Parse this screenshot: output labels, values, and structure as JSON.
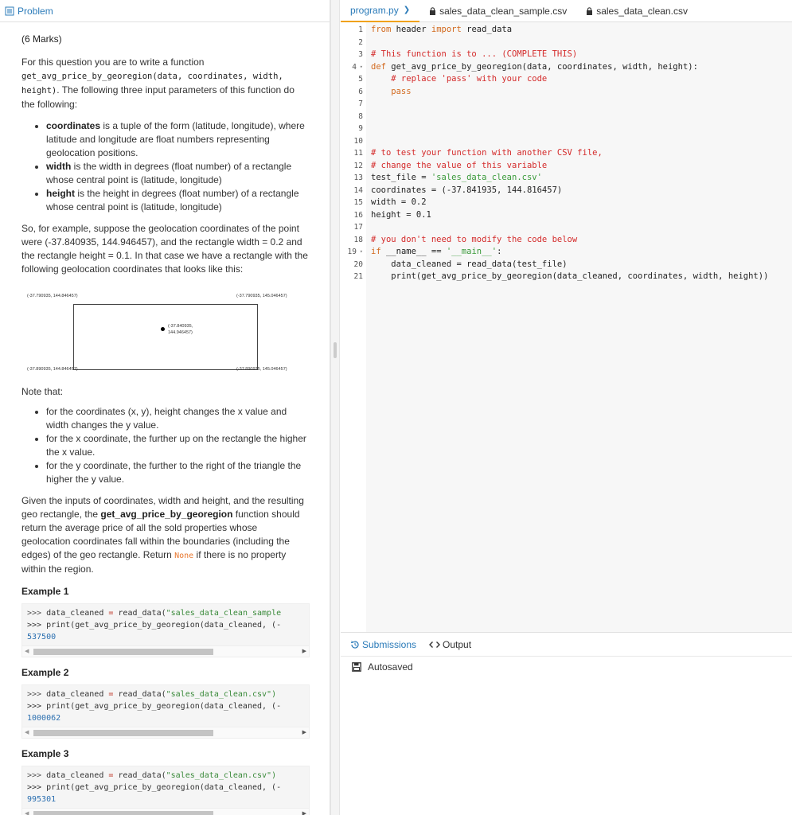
{
  "left_tab": {
    "label": "Problem"
  },
  "problem": {
    "marks": "(6 Marks)",
    "intro_a": "For this question you are to write a function",
    "intro_code": "get_avg_price_by_georegion(data, coordinates, width, height)",
    "intro_b": ". The following three input parameters of this function do the following:",
    "params": [
      {
        "name": "coordinates",
        "desc": " is a tuple of the form (latitude, longitude), where latitude and longitude are float numbers representing geolocation positions."
      },
      {
        "name": "width",
        "desc": " is the width in degrees (float number) of a rectangle whose central point is (latitude, longitude)"
      },
      {
        "name": "height",
        "desc": " is the height in degrees (float number) of a rectangle whose central point is (latitude, longitude)"
      }
    ],
    "example_para": "So, for example, suppose the geolocation coordinates of the point were (-37.840935, 144.946457), and the rectangle width = 0.2 and the rectangle height = 0.1. In that case we have a rectangle with the following geolocation coordinates that looks like this:",
    "figure": {
      "top_left": "(-37.790935, 144.846457)",
      "top_right": "(-37.790935, 145.046457)",
      "center_line1": "(-37.840935,",
      "center_line2": "144.946457)",
      "bottom_left": "(-37.890935, 144.846457)",
      "bottom_right": "(-37.890935, 145.046457)"
    },
    "note_heading": "Note that:",
    "notes": [
      "for the coordinates (x, y), height changes the x value and width changes the y value.",
      "for the x coordinate, the further up on the rectangle the higher the x value.",
      "for the y coordinate, the further to the right of the triangle the higher the y value."
    ],
    "final_a": "Given the inputs of coordinates, width and height, and the resulting geo rectangle, the ",
    "final_fn": "get_avg_price_by_georegion",
    "final_b": " function should return the average price of all the sold properties whose geolocation coordinates fall within the boundaries (including the edges) of the geo rectangle. Return ",
    "final_none": "None",
    "final_c": " if there is no property within the region.",
    "examples": [
      {
        "title": "Example 1",
        "file": "\"sales_data_clean_sample",
        "result": "537500"
      },
      {
        "title": "Example 2",
        "file": "\"sales_data_clean.csv\")",
        "result": "1000062"
      },
      {
        "title": "Example 3",
        "file": "\"sales_data_clean.csv\")",
        "result": "995301"
      }
    ],
    "example_line1_prefix": ">>> ",
    "example_line1_var": "data_cleaned",
    "example_line1_eq": " = ",
    "example_line1_call": "read_data(",
    "example_line2": ">>> print(get_avg_price_by_georegion(data_cleaned, (-"
  },
  "file_tabs": [
    {
      "label": "program.py",
      "active": true
    },
    {
      "label": "sales_data_clean_sample.csv",
      "active": false
    },
    {
      "label": "sales_data_clean.csv",
      "active": false
    }
  ],
  "editor": {
    "lines": [
      "1",
      "2",
      "3",
      "4",
      "5",
      "6",
      "7",
      "8",
      "9",
      "10",
      "11",
      "12",
      "13",
      "14",
      "15",
      "16",
      "17",
      "18",
      "19",
      "20",
      "21"
    ],
    "l1_from": "from",
    "l1_mod": " header ",
    "l1_import": "import",
    "l1_name": " read_data",
    "l3": "# This function is to ... (COMPLETE THIS)",
    "l4_def": "def",
    "l4_rest": " get_avg_price_by_georegion(data, coordinates, width, height):",
    "l5": "    # replace 'pass' with your code",
    "l6": "    pass",
    "l11": "# to test your function with another CSV file,",
    "l12": "# change the value of this variable",
    "l13_a": "test_file = ",
    "l13_s": "'sales_data_clean.csv'",
    "l14": "coordinates = (-37.841935, 144.816457)",
    "l15": "width = 0.2",
    "l16": "height = 0.1",
    "l18": "# you don't need to modify the code below",
    "l19_if": "if",
    "l19_a": " __name__ == ",
    "l19_s": "'__main__'",
    "l19_c": ":",
    "l20": "    data_cleaned = read_data(test_file)",
    "l21": "    print(get_avg_price_by_georegion(data_cleaned, coordinates, width, height))"
  },
  "bottom_tabs": [
    {
      "label": "Submissions",
      "icon": "history-icon",
      "active": true
    },
    {
      "label": "Output",
      "icon": "code-icon",
      "active": false
    }
  ],
  "status": {
    "autosaved": "Autosaved",
    "icon": "save-icon"
  },
  "colors": {
    "accent": "#2b7bb9",
    "tab_underline": "#f0a21a",
    "comment": "#d42b2b",
    "string": "#3a9a3a",
    "keyword": "#d2691e"
  }
}
